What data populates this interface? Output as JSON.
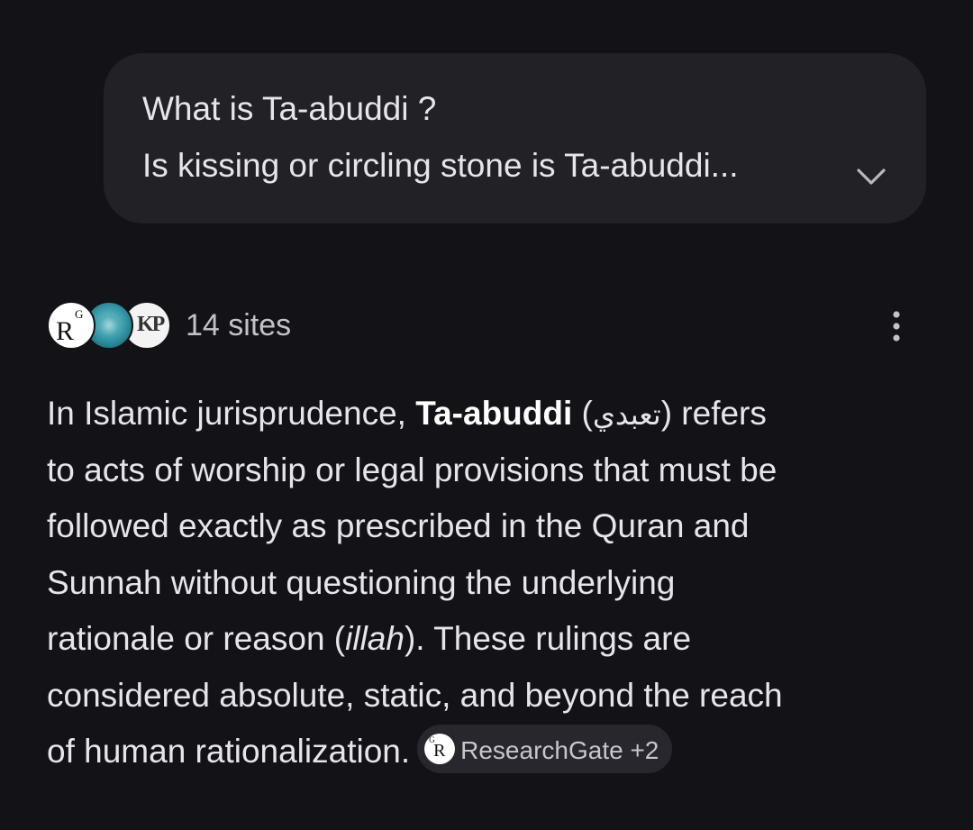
{
  "query": {
    "line1": "What is Ta-abuddi ?",
    "line2": "Is kissing or circling stone is Ta-abuddi...",
    "expand_icon": "chevron-down-icon"
  },
  "sources": {
    "favicons": [
      "researchgate-favicon",
      "globe-favicon",
      "kp-favicon"
    ],
    "rg_letter": "R",
    "rg_super": "G",
    "kp_letters": "KP",
    "count_label": "14 sites",
    "menu_icon": "more-vert-icon"
  },
  "answer": {
    "line1_pre": "In Islamic jurisprudence, ",
    "line1_term": "Ta-abuddi",
    "line1_open": " (",
    "line1_arabic": "تعبدي",
    "line1_post": ") refers",
    "line2": "to acts of worship or legal provisions that must be",
    "line3": "followed exactly as prescribed in the Quran and",
    "line4": "Sunnah without questioning the underlying",
    "line5_pre": "rationale or reason (",
    "line5_italic": "illah",
    "line5_post": "). These rulings are",
    "line6": "considered absolute, static, and beyond the reach",
    "line7": "of human rationalization.",
    "citation": {
      "label": "ResearchGate +2",
      "icon": "researchgate-icon",
      "icon_letter": "R",
      "icon_super": "G"
    }
  },
  "colors": {
    "background": "#131317",
    "bubble": "#212126",
    "text": "#e6e5ea",
    "muted_text": "#c3c2c9",
    "chip_background": "#27272d"
  }
}
